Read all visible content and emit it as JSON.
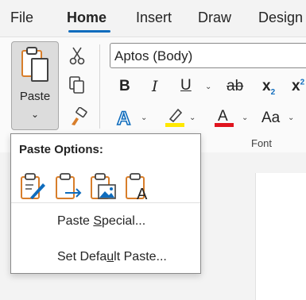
{
  "tabs": [
    {
      "label": "File"
    },
    {
      "label": "Home"
    },
    {
      "label": "Insert"
    },
    {
      "label": "Draw"
    },
    {
      "label": "Design"
    }
  ],
  "active_tab": "Home",
  "clipboard": {
    "paste_label": "Paste"
  },
  "font": {
    "name": "Aptos (Body)",
    "group_label": "Font",
    "bold": "B",
    "italic": "I",
    "underline": "U",
    "strikethrough": "ab",
    "subscript": "x",
    "superscript": "x",
    "font_size_label": "Aa",
    "highlight_color": "#ffe800",
    "font_color": "#e0141e",
    "text_effects_color": "#0f6cbd"
  },
  "paste_menu": {
    "title": "Paste Options:",
    "items": [
      {
        "pre": "Paste ",
        "u": "S",
        "post": "pecial..."
      },
      {
        "pre": "Set Defa",
        "u": "u",
        "post": "lt Paste..."
      }
    ]
  },
  "colors": {
    "accent": "#0f6cbd",
    "clipboard_orange": "#d87e2b"
  }
}
